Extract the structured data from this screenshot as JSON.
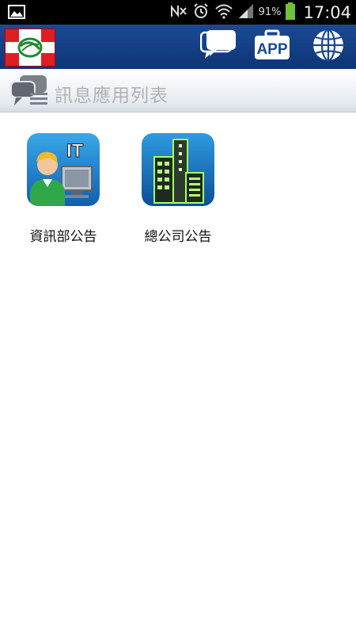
{
  "status_bar": {
    "battery_percent": "91%",
    "time": "17:04",
    "icons": [
      "image-icon",
      "signal-off-icon",
      "alarm-icon",
      "wifi-icon",
      "cell-signal-icon",
      "battery-icon"
    ]
  },
  "header": {
    "logo": "company-logo",
    "nav": [
      {
        "name": "messages",
        "icon": "chat-bubble-icon",
        "selected": true
      },
      {
        "name": "apps",
        "label": "APP",
        "icon": "briefcase-icon",
        "selected": false
      },
      {
        "name": "web",
        "icon": "globe-icon",
        "selected": false
      }
    ],
    "accent_color": "#46c84a",
    "bar_color": "#1b4a92"
  },
  "section": {
    "title": "訊息應用列表",
    "icon": "chat-bubbles-icon"
  },
  "apps": [
    {
      "label": "資訊部公告",
      "icon": "it-department-icon"
    },
    {
      "label": "總公司公告",
      "icon": "head-office-building-icon"
    }
  ]
}
